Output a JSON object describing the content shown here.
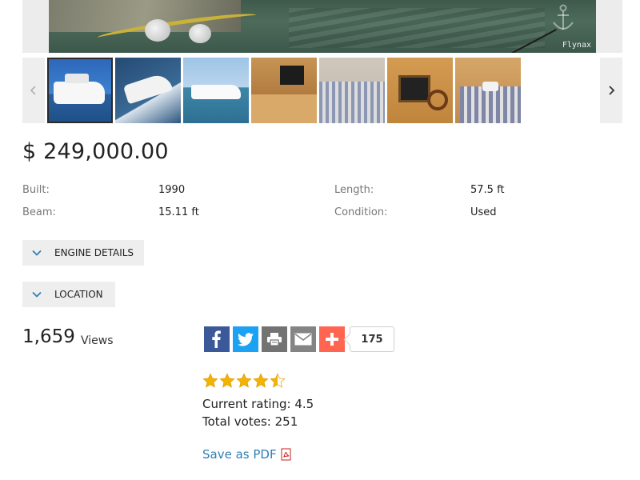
{
  "gallery": {
    "watermark": "Flynax",
    "thumbnails": [
      {
        "name": "Yacht exterior",
        "active": true
      },
      {
        "name": "Yacht cruising"
      },
      {
        "name": "Yacht side view"
      },
      {
        "name": "Salon TV"
      },
      {
        "name": "Lounge seating"
      },
      {
        "name": "Helm station"
      },
      {
        "name": "Cabin bed"
      }
    ]
  },
  "listing": {
    "price": "$ 249,000.00",
    "specs": {
      "built_label": "Built:",
      "built_value": "1990",
      "length_label": "Length:",
      "length_value": "57.5 ft",
      "beam_label": "Beam:",
      "beam_value": "15.11 ft",
      "condition_label": "Condition:",
      "condition_value": "Used"
    }
  },
  "sections": {
    "engine_details": "ENGINE DETAILS",
    "location": "LOCATION"
  },
  "stats": {
    "views_count": "1,659",
    "views_label": "Views"
  },
  "share": {
    "buttons": [
      "facebook",
      "twitter",
      "print",
      "email",
      "more"
    ],
    "count": "175",
    "colors": {
      "facebook": "#3b5998",
      "twitter": "#1da1f2",
      "print": "#737373",
      "email": "#848484",
      "more": "#ff6550"
    }
  },
  "rating": {
    "stars": 4.5,
    "max_stars": 5,
    "current_rating": "Current rating: 4.5",
    "total_votes": "Total votes: 251",
    "star_color": "#f5b301"
  },
  "actions": {
    "save_pdf": "Save as PDF"
  }
}
